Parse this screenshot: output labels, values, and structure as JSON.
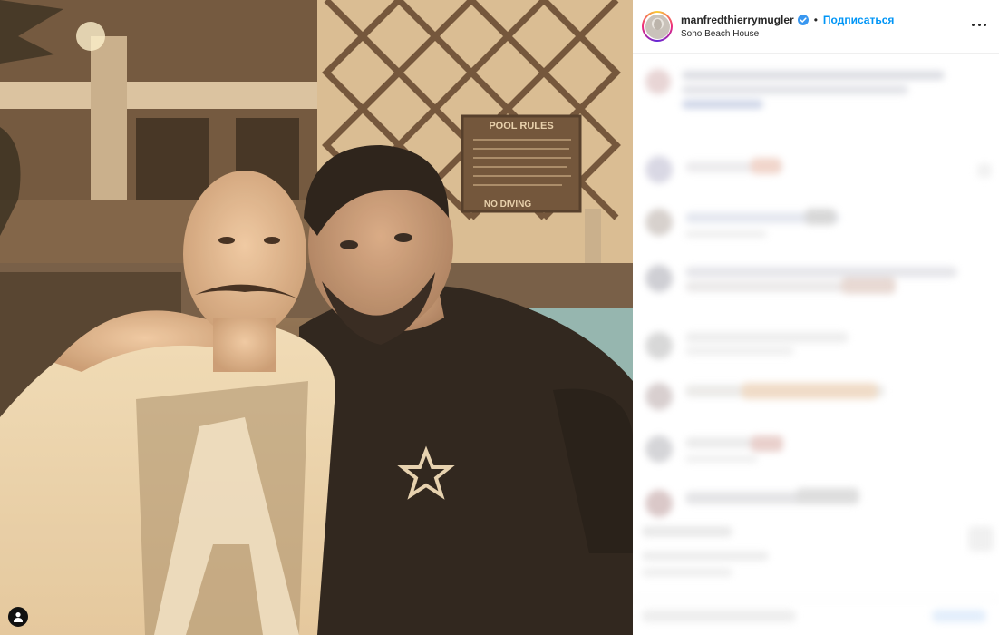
{
  "post": {
    "username": "manfredthierrymugler",
    "separator": "•",
    "follow_label": "Подписаться",
    "location": "Soho Beach House"
  },
  "photo": {
    "sign_title": "POOL RULES",
    "sign_footer": "NO DIVING"
  },
  "icons": {
    "verified": "verified-badge-icon",
    "more": "more-options-icon",
    "tag": "user-tag-icon"
  },
  "colors": {
    "follow": "#0095f6",
    "text": "#262626",
    "verified": "#3897f0"
  }
}
